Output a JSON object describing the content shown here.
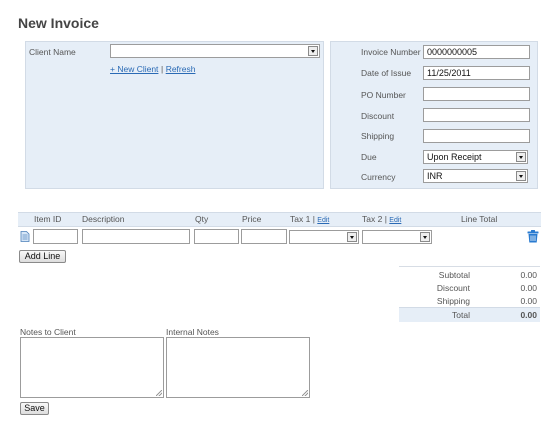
{
  "page": {
    "title": "New Invoice"
  },
  "client": {
    "label": "Client Name",
    "value": "",
    "new_client_link": "+ New Client",
    "separator": "|",
    "refresh_link": "Refresh"
  },
  "invoice_fields": {
    "invoice_number": {
      "label": "Invoice Number",
      "value": "0000000005"
    },
    "date_of_issue": {
      "label": "Date of Issue",
      "value": "11/25/2011"
    },
    "po_number": {
      "label": "PO Number",
      "value": ""
    },
    "discount": {
      "label": "Discount",
      "value": ""
    },
    "shipping": {
      "label": "Shipping",
      "value": ""
    },
    "due": {
      "label": "Due",
      "value": "Upon Receipt"
    },
    "currency": {
      "label": "Currency",
      "value": "INR"
    }
  },
  "line_items": {
    "headers": {
      "item_id": "Item ID",
      "description": "Description",
      "qty": "Qty",
      "price": "Price",
      "tax1": "Tax 1",
      "tax2": "Tax 2",
      "tax_sep": "|",
      "edit": "Edit",
      "line_total": "Line Total"
    },
    "row": {
      "item_id": "",
      "description": "",
      "qty": "",
      "price": "",
      "tax1": "",
      "tax2": ""
    },
    "add_line_label": "Add Line"
  },
  "totals": {
    "subtotal": {
      "label": "Subtotal",
      "value": "0.00"
    },
    "discount": {
      "label": "Discount",
      "value": "0.00"
    },
    "shipping": {
      "label": "Shipping",
      "value": "0.00"
    },
    "total": {
      "label": "Total",
      "value": "0.00"
    }
  },
  "notes": {
    "client_label": "Notes to Client",
    "internal_label": "Internal Notes"
  },
  "actions": {
    "save_label": "Save"
  },
  "icons": {
    "row_icon": "document-icon",
    "delete_icon": "trash-icon"
  },
  "colors": {
    "panel_bg": "#e6eef7",
    "link": "#2a6ab5",
    "delete_icon": "#2a7bd0"
  }
}
